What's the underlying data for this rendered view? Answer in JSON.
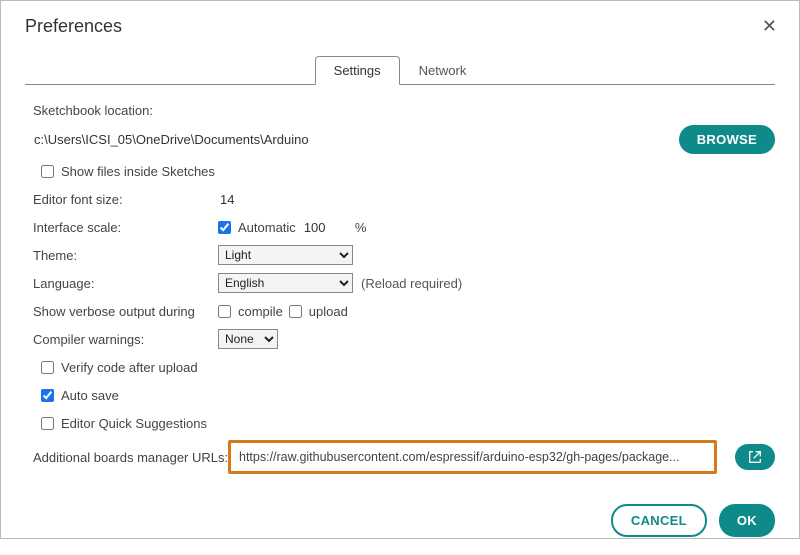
{
  "window": {
    "title": "Preferences"
  },
  "tabs": {
    "settings": "Settings",
    "network": "Network"
  },
  "labels": {
    "sketchbook": "Sketchbook location:",
    "showFiles": "Show files inside Sketches",
    "fontSize": "Editor font size:",
    "interfaceScale": "Interface scale:",
    "automatic": "Automatic",
    "percent": "%",
    "theme": "Theme:",
    "language": "Language:",
    "reload": "(Reload required)",
    "verbose": "Show verbose output during",
    "compile": "compile",
    "upload": "upload",
    "compilerWarnings": "Compiler warnings:",
    "verifyAfterUpload": "Verify code after upload",
    "autoSave": "Auto save",
    "quickSuggestions": "Editor Quick Suggestions",
    "additionalUrls": "Additional boards manager URLs:"
  },
  "values": {
    "sketchbookPath": "c:\\Users\\ICSI_05\\OneDrive\\Documents\\Arduino",
    "fontSize": "14",
    "scale": "100",
    "theme": "Light",
    "language": "English",
    "compilerWarnings": "None",
    "urls": "https://raw.githubusercontent.com/espressif/arduino-esp32/gh-pages/package..."
  },
  "buttons": {
    "browse": "BROWSE",
    "cancel": "CANCEL",
    "ok": "OK"
  }
}
